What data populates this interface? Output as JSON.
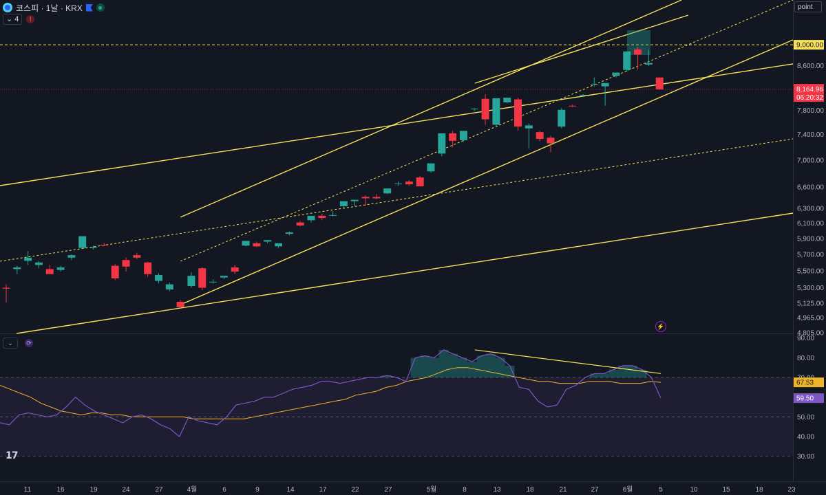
{
  "header": {
    "symbol_title": "코스피 · 1날 · KRX",
    "indicator_count": "4",
    "scale_button": "point",
    "rsi_collapse": "⌄"
  },
  "colors": {
    "background": "#131722",
    "up": "#26a69a",
    "down": "#f23645",
    "trendline": "#f7e15a",
    "rsi": "#7e57c2",
    "rsi_ma": "#f0b429",
    "price_tag": "#f23645"
  },
  "price_tags": {
    "level_label": "9,000.00",
    "last_price": "8,164.96",
    "countdown": "06:20:32"
  },
  "rsi_tags": {
    "ma": "67.53",
    "rsi": "59.50"
  },
  "chart_data": [
    {
      "type": "candlestick",
      "title": "코스피 · 1날 · KRX",
      "y_scale": "log",
      "ylim": [
        4805,
        9600
      ],
      "y_ticks": [
        "9,000.00",
        "8,600.00",
        "7,800.00",
        "7,400.00",
        "7,000.00",
        "6,600.00",
        "6,300.00",
        "6,100.00",
        "5,900.00",
        "5,700.00",
        "5,500.00",
        "5,300.00",
        "5,125.00",
        "4,965.00",
        "4,805.00"
      ],
      "y_tick_values": [
        9000,
        8600,
        7800,
        7400,
        7000,
        6600,
        6300,
        6100,
        5900,
        5700,
        5500,
        5300,
        5125,
        4965,
        4805
      ],
      "x_ticks": [
        "11",
        "16",
        "19",
        "24",
        "27",
        "4월",
        "6",
        "9",
        "14",
        "17",
        "22",
        "27",
        "5월",
        "8",
        "13",
        "18",
        "21",
        "27",
        "6월",
        "5",
        "10",
        "15",
        "18",
        "23"
      ],
      "candles": [
        {
          "o": 5300,
          "h": 5340,
          "l": 5130,
          "c": 5290
        },
        {
          "o": 5520,
          "h": 5560,
          "l": 5460,
          "c": 5540
        },
        {
          "o": 5620,
          "h": 5740,
          "l": 5570,
          "c": 5660
        },
        {
          "o": 5570,
          "h": 5620,
          "l": 5530,
          "c": 5600
        },
        {
          "o": 5520,
          "h": 5570,
          "l": 5490,
          "c": 5460
        },
        {
          "o": 5510,
          "h": 5560,
          "l": 5490,
          "c": 5540
        },
        {
          "o": 5660,
          "h": 5700,
          "l": 5630,
          "c": 5690
        },
        {
          "o": 5780,
          "h": 5800,
          "l": 5770,
          "c": 5930
        },
        {
          "o": 5780,
          "h": 5810,
          "l": 5760,
          "c": 5790
        },
        {
          "o": 5820,
          "h": 5840,
          "l": 5800,
          "c": 5810
        },
        {
          "o": 5560,
          "h": 5580,
          "l": 5390,
          "c": 5410
        },
        {
          "o": 5630,
          "h": 5660,
          "l": 5490,
          "c": 5550
        },
        {
          "o": 5690,
          "h": 5720,
          "l": 5640,
          "c": 5660
        },
        {
          "o": 5600,
          "h": 5610,
          "l": 5430,
          "c": 5460
        },
        {
          "o": 5380,
          "h": 5470,
          "l": 5350,
          "c": 5450
        },
        {
          "o": 5280,
          "h": 5360,
          "l": 5260,
          "c": 5340
        },
        {
          "o": 5140,
          "h": 5160,
          "l": 5070,
          "c": 5080
        },
        {
          "o": 5320,
          "h": 5480,
          "l": 5300,
          "c": 5440
        },
        {
          "o": 5530,
          "h": 5540,
          "l": 5270,
          "c": 5300
        },
        {
          "o": 5370,
          "h": 5400,
          "l": 5350,
          "c": 5370
        },
        {
          "o": 5420,
          "h": 5440,
          "l": 5400,
          "c": 5440
        },
        {
          "o": 5540,
          "h": 5570,
          "l": 5460,
          "c": 5490
        },
        {
          "o": 5810,
          "h": 5830,
          "l": 5800,
          "c": 5870
        },
        {
          "o": 5840,
          "h": 5860,
          "l": 5790,
          "c": 5800
        },
        {
          "o": 5860,
          "h": 5880,
          "l": 5840,
          "c": 5880
        },
        {
          "o": 5800,
          "h": 5820,
          "l": 5780,
          "c": 5840
        },
        {
          "o": 5960,
          "h": 5990,
          "l": 5940,
          "c": 5980
        },
        {
          "o": 6110,
          "h": 6130,
          "l": 6060,
          "c": 6070
        },
        {
          "o": 6140,
          "h": 6180,
          "l": 6110,
          "c": 6200
        },
        {
          "o": 6200,
          "h": 6230,
          "l": 6140,
          "c": 6170
        },
        {
          "o": 6200,
          "h": 6260,
          "l": 6190,
          "c": 6210
        },
        {
          "o": 6330,
          "h": 6370,
          "l": 6310,
          "c": 6400
        },
        {
          "o": 6400,
          "h": 6420,
          "l": 6330,
          "c": 6420
        },
        {
          "o": 6460,
          "h": 6480,
          "l": 6340,
          "c": 6440
        },
        {
          "o": 6460,
          "h": 6500,
          "l": 6430,
          "c": 6440
        },
        {
          "o": 6510,
          "h": 6580,
          "l": 6500,
          "c": 6580
        },
        {
          "o": 6640,
          "h": 6680,
          "l": 6620,
          "c": 6650
        },
        {
          "o": 6680,
          "h": 6700,
          "l": 6620,
          "c": 6640
        },
        {
          "o": 6740,
          "h": 6760,
          "l": 6610,
          "c": 6610
        },
        {
          "o": 6830,
          "h": 6890,
          "l": 6810,
          "c": 6950
        },
        {
          "o": 7100,
          "h": 7120,
          "l": 7060,
          "c": 7420
        },
        {
          "o": 7420,
          "h": 7460,
          "l": 7200,
          "c": 7300
        },
        {
          "o": 7310,
          "h": 7360,
          "l": 7290,
          "c": 7460
        },
        {
          "o": 7820,
          "h": 7840,
          "l": 7790,
          "c": 7830
        },
        {
          "o": 8000,
          "h": 8080,
          "l": 7560,
          "c": 7650
        },
        {
          "o": 7560,
          "h": 7600,
          "l": 7530,
          "c": 8010
        },
        {
          "o": 7940,
          "h": 7960,
          "l": 7920,
          "c": 8020
        },
        {
          "o": 7990,
          "h": 8020,
          "l": 7460,
          "c": 7530
        },
        {
          "o": 7500,
          "h": 7580,
          "l": 7180,
          "c": 7550
        },
        {
          "o": 7440,
          "h": 7460,
          "l": 7290,
          "c": 7330
        },
        {
          "o": 7350,
          "h": 7380,
          "l": 7120,
          "c": 7260
        },
        {
          "o": 7530,
          "h": 7840,
          "l": 7500,
          "c": 7810
        },
        {
          "o": 7880,
          "h": 7900,
          "l": 7860,
          "c": 7870
        },
        {
          "o": 8060,
          "h": 8080,
          "l": 8030,
          "c": 8070
        },
        {
          "o": 8250,
          "h": 8380,
          "l": 8220,
          "c": 8260
        },
        {
          "o": 8220,
          "h": 8280,
          "l": 7880,
          "c": 8280
        },
        {
          "o": 8410,
          "h": 8430,
          "l": 8380,
          "c": 8470
        },
        {
          "o": 8520,
          "h": 8540,
          "l": 8490,
          "c": 8870
        },
        {
          "o": 8910,
          "h": 8960,
          "l": 8530,
          "c": 8810
        },
        {
          "o": 8620,
          "h": 8900,
          "l": 8590,
          "c": 8650
        },
        {
          "o": 8380,
          "h": 8380,
          "l": 8160,
          "c": 8165
        }
      ]
    },
    {
      "type": "line",
      "title": "",
      "ylim": [
        25,
        92
      ],
      "y_ticks": [
        "90.00",
        "80.00",
        "70.00",
        "60.00",
        "50.00",
        "40.00",
        "30.00"
      ],
      "y_tick_values": [
        90,
        80,
        70,
        60,
        50,
        40,
        30
      ],
      "bands": {
        "upper": 70,
        "middle": 50,
        "lower": 30
      },
      "series": [
        {
          "role": "rsi",
          "values": [
            47,
            46,
            51,
            52,
            51,
            50,
            51,
            55,
            60,
            56,
            53,
            51,
            49,
            47,
            50,
            51,
            49,
            46,
            44,
            40,
            50,
            48,
            47,
            46,
            50,
            56,
            57,
            58,
            60,
            60,
            62,
            64,
            65,
            66,
            68,
            68,
            67,
            68,
            69,
            70,
            70,
            71,
            70,
            68,
            80,
            81,
            80,
            84,
            82,
            80,
            78,
            81,
            82,
            80,
            76,
            65,
            64,
            58,
            55,
            56,
            64,
            66,
            70,
            72,
            72,
            74,
            76,
            76,
            74,
            70,
            59.5
          ]
        },
        {
          "role": "rsi_ma",
          "values": [
            66,
            64,
            62,
            60,
            57,
            55,
            53,
            52,
            51,
            52,
            52,
            51,
            51,
            50,
            50,
            50,
            50,
            50,
            50,
            49,
            49,
            49,
            49,
            49,
            49,
            50,
            51,
            52,
            53,
            54,
            55,
            56,
            57,
            58,
            59,
            61,
            62,
            63,
            65,
            66,
            68,
            69,
            70,
            72,
            74,
            75,
            75,
            74,
            73,
            72,
            71,
            70,
            69,
            68,
            68,
            67,
            67,
            67,
            68,
            68,
            68,
            67,
            67,
            67,
            68,
            67.53
          ]
        }
      ]
    }
  ]
}
